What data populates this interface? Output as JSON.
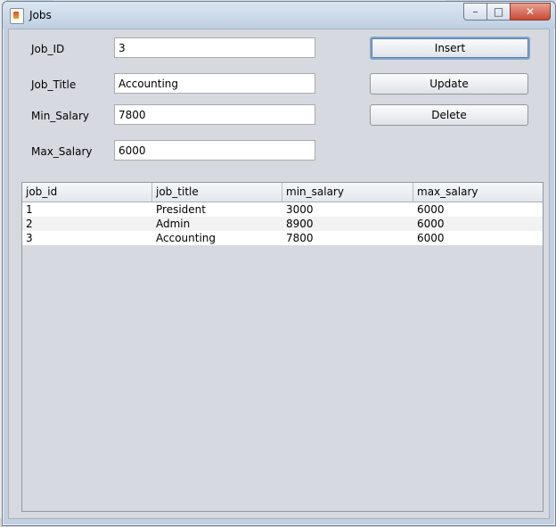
{
  "window": {
    "title": "Jobs",
    "icon": "java-app-icon"
  },
  "controls": {
    "minimize": "–",
    "maximize": "□",
    "close": "✕"
  },
  "form": {
    "job_id": {
      "label": "Job_ID",
      "value": "3"
    },
    "job_title": {
      "label": "Job_Title",
      "value": "Accounting"
    },
    "min_salary": {
      "label": "Min_Salary",
      "value": "7800"
    },
    "max_salary": {
      "label": "Max_Salary",
      "value": "6000"
    }
  },
  "buttons": {
    "insert": "Insert",
    "update": "Update",
    "delete": "Delete"
  },
  "table": {
    "columns": [
      "job_id",
      "job_title",
      "min_salary",
      "max_salary"
    ],
    "rows": [
      [
        "1",
        "President",
        "3000",
        "6000"
      ],
      [
        "2",
        "Admin",
        "8900",
        "6000"
      ],
      [
        "3",
        "Accounting",
        "7800",
        "6000"
      ]
    ]
  }
}
